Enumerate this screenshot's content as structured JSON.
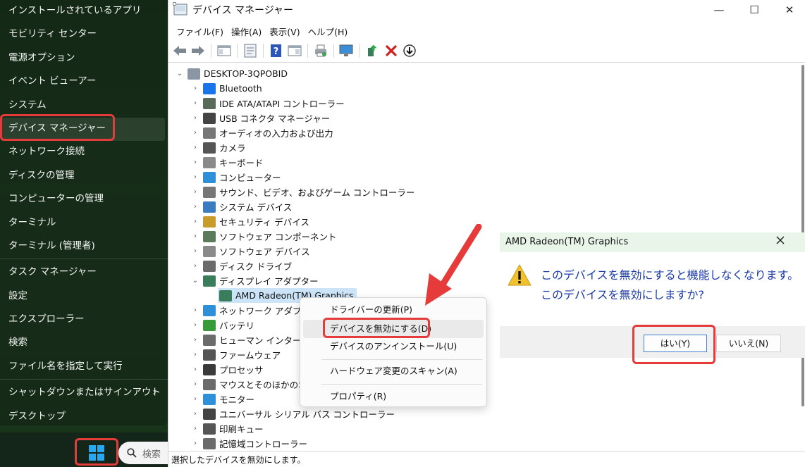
{
  "winx_menu": {
    "items": [
      {
        "label": "インストールされているアプリ"
      },
      {
        "label": "モビリティ センター"
      },
      {
        "label": "電源オプション"
      },
      {
        "label": "イベント ビューアー"
      },
      {
        "label": "システム"
      },
      {
        "label": "デバイス マネージャー",
        "selected": true
      },
      {
        "label": "ネットワーク接続"
      },
      {
        "label": "ディスクの管理"
      },
      {
        "label": "コンピューターの管理"
      },
      {
        "label": "ターミナル"
      },
      {
        "label": "ターミナル (管理者)"
      },
      {
        "label": "タスク マネージャー"
      },
      {
        "label": "設定"
      },
      {
        "label": "エクスプローラー"
      },
      {
        "label": "検索"
      },
      {
        "label": "ファイル名を指定して実行"
      },
      {
        "label": "シャットダウンまたはサインアウト"
      },
      {
        "label": "デスクトップ"
      }
    ]
  },
  "taskbar": {
    "search_label": "検索"
  },
  "device_manager": {
    "title": "デバイス マネージャー",
    "window_controls": {
      "minimize": "—",
      "maximize": "☐",
      "close": "✕"
    },
    "menubar": [
      "ファイル(F)",
      "操作(A)",
      "表示(V)",
      "ヘルプ(H)"
    ],
    "tree": {
      "root": "DESKTOP-3QPOBID",
      "categories": [
        {
          "label": "Bluetooth",
          "icon": "bluetooth-icon",
          "color": "#1a73e8"
        },
        {
          "label": "IDE ATA/ATAPI コントローラー",
          "icon": "ide-controller-icon",
          "color": "#5a6b5a"
        },
        {
          "label": "USB コネクタ マネージャー",
          "icon": "usb-icon",
          "color": "#444444"
        },
        {
          "label": "オーディオの入力および出力",
          "icon": "speaker-icon",
          "color": "#777777"
        },
        {
          "label": "カメラ",
          "icon": "camera-icon",
          "color": "#555555"
        },
        {
          "label": "キーボード",
          "icon": "keyboard-icon",
          "color": "#8a8a8a"
        },
        {
          "label": "コンピューター",
          "icon": "computer-icon",
          "color": "#2f8fd8"
        },
        {
          "label": "サウンド、ビデオ、およびゲーム コントローラー",
          "icon": "sound-icon",
          "color": "#777777"
        },
        {
          "label": "システム デバイス",
          "icon": "system-device-icon",
          "color": "#3b7bbf"
        },
        {
          "label": "セキュリティ デバイス",
          "icon": "security-icon",
          "color": "#c89b2b"
        },
        {
          "label": "ソフトウェア コンポーネント",
          "icon": "software-component-icon",
          "color": "#5c7a5c"
        },
        {
          "label": "ソフトウェア デバイス",
          "icon": "software-device-icon",
          "color": "#8a8a8a"
        },
        {
          "label": "ディスク ドライブ",
          "icon": "disk-icon",
          "color": "#6b6b6b"
        },
        {
          "label": "ディスプレイ アダプター",
          "icon": "display-adapter-icon",
          "color": "#3a7d5a",
          "expanded": true
        },
        {
          "label": "ネットワーク アダプター",
          "icon": "network-icon",
          "color": "#2f8fd8"
        },
        {
          "label": "バッテリ",
          "icon": "battery-icon",
          "color": "#3a9a3a"
        },
        {
          "label": "ヒューマン インターフェイス デバイス",
          "icon": "hid-icon",
          "color": "#6b6b6b"
        },
        {
          "label": "ファームウェア",
          "icon": "firmware-icon",
          "color": "#555555"
        },
        {
          "label": "プロセッサ",
          "icon": "processor-icon",
          "color": "#3a3a3a"
        },
        {
          "label": "マウスとそのほかのポインティング デバイス",
          "icon": "mouse-icon",
          "color": "#6b6b6b"
        },
        {
          "label": "モニター",
          "icon": "monitor-icon",
          "color": "#2f8fd8"
        },
        {
          "label": "ユニバーサル シリアル バス コントローラー",
          "icon": "usb-controller-icon",
          "color": "#444444"
        },
        {
          "label": "印刷キュー",
          "icon": "printer-icon",
          "color": "#555555"
        },
        {
          "label": "記憶域コントローラー",
          "icon": "storage-controller-icon",
          "color": "#6b6b6b"
        }
      ],
      "selected_child": "AMD Radeon(TM) Graphics"
    },
    "status": "選択したデバイスを無効にします。"
  },
  "context_menu": {
    "items": [
      {
        "label": "ドライバーの更新(P)"
      },
      {
        "label": "デバイスを無効にする(D)",
        "highlighted": true
      },
      {
        "label": "デバイスのアンインストール(U)"
      },
      {
        "label": "ハードウェア変更のスキャン(A)"
      },
      {
        "label": "プロパティ(R)"
      }
    ]
  },
  "dialog": {
    "title": "AMD Radeon(TM) Graphics",
    "message_line1": "このデバイスを無効にすると機能しなくなります。",
    "message_line2": "このデバイスを無効にしますか?",
    "yes": "はい(Y)",
    "no": "いいえ(N)"
  },
  "colors": {
    "highlight_red": "#e63b3b",
    "dialog_text": "#1b3aa8",
    "selection_blue": "#cce4f7"
  }
}
